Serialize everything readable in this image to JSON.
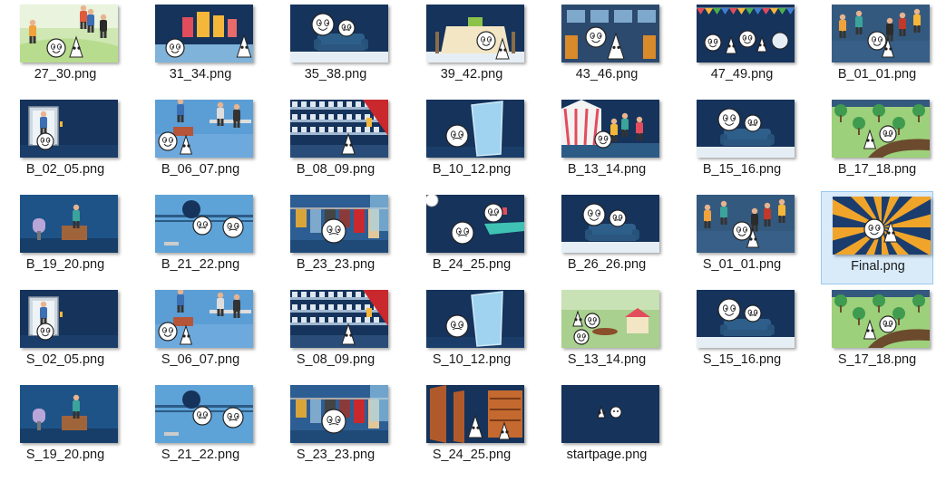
{
  "window": {
    "type": "file-explorer-thumbnail-view"
  },
  "colors": {
    "navy": "#15335b",
    "navyLight": "#1f4872",
    "selection": "#d9ebf9",
    "selectionBorder": "#99c9ef"
  },
  "selected_index": 20,
  "files": [
    {
      "name": "27_30.png",
      "scene": "park"
    },
    {
      "name": "31_34.png",
      "scene": "drinks"
    },
    {
      "name": "35_38.png",
      "scene": "sofa"
    },
    {
      "name": "39_42.png",
      "scene": "table"
    },
    {
      "name": "43_46.png",
      "scene": "bus"
    },
    {
      "name": "47_49.png",
      "scene": "party"
    },
    {
      "name": "B_01_01.png",
      "scene": "crowd"
    },
    {
      "name": "B_02_05.png",
      "scene": "elevator"
    },
    {
      "name": "B_06_07.png",
      "scene": "office"
    },
    {
      "name": "B_08_09.png",
      "scene": "supermarket"
    },
    {
      "name": "B_10_12.png",
      "scene": "mirror"
    },
    {
      "name": "B_13_14.png",
      "scene": "circus"
    },
    {
      "name": "B_15_16.png",
      "scene": "sofa"
    },
    {
      "name": "B_17_18.png",
      "scene": "garden"
    },
    {
      "name": "B_19_20.png",
      "scene": "desk"
    },
    {
      "name": "B_21_22.png",
      "scene": "gym"
    },
    {
      "name": "B_23_23.png",
      "scene": "clothes"
    },
    {
      "name": "B_24_25.png",
      "scene": "cafe"
    },
    {
      "name": "B_26_26.png",
      "scene": "sofa"
    },
    {
      "name": "S_01_01.png",
      "scene": "crowd"
    },
    {
      "name": "Final.png",
      "scene": "sunburst"
    },
    {
      "name": "S_02_05.png",
      "scene": "elevator"
    },
    {
      "name": "S_06_07.png",
      "scene": "office"
    },
    {
      "name": "S_08_09.png",
      "scene": "supermarket"
    },
    {
      "name": "S_10_12.png",
      "scene": "mirror"
    },
    {
      "name": "S_13_14.png",
      "scene": "fair"
    },
    {
      "name": "S_15_16.png",
      "scene": "sofa"
    },
    {
      "name": "S_17_18.png",
      "scene": "garden"
    },
    {
      "name": "S_19_20.png",
      "scene": "desk"
    },
    {
      "name": "S_21_22.png",
      "scene": "gym"
    },
    {
      "name": "S_23_23.png",
      "scene": "clothes"
    },
    {
      "name": "S_24_25.png",
      "scene": "library"
    },
    {
      "name": "startpage.png",
      "scene": "blank"
    }
  ]
}
